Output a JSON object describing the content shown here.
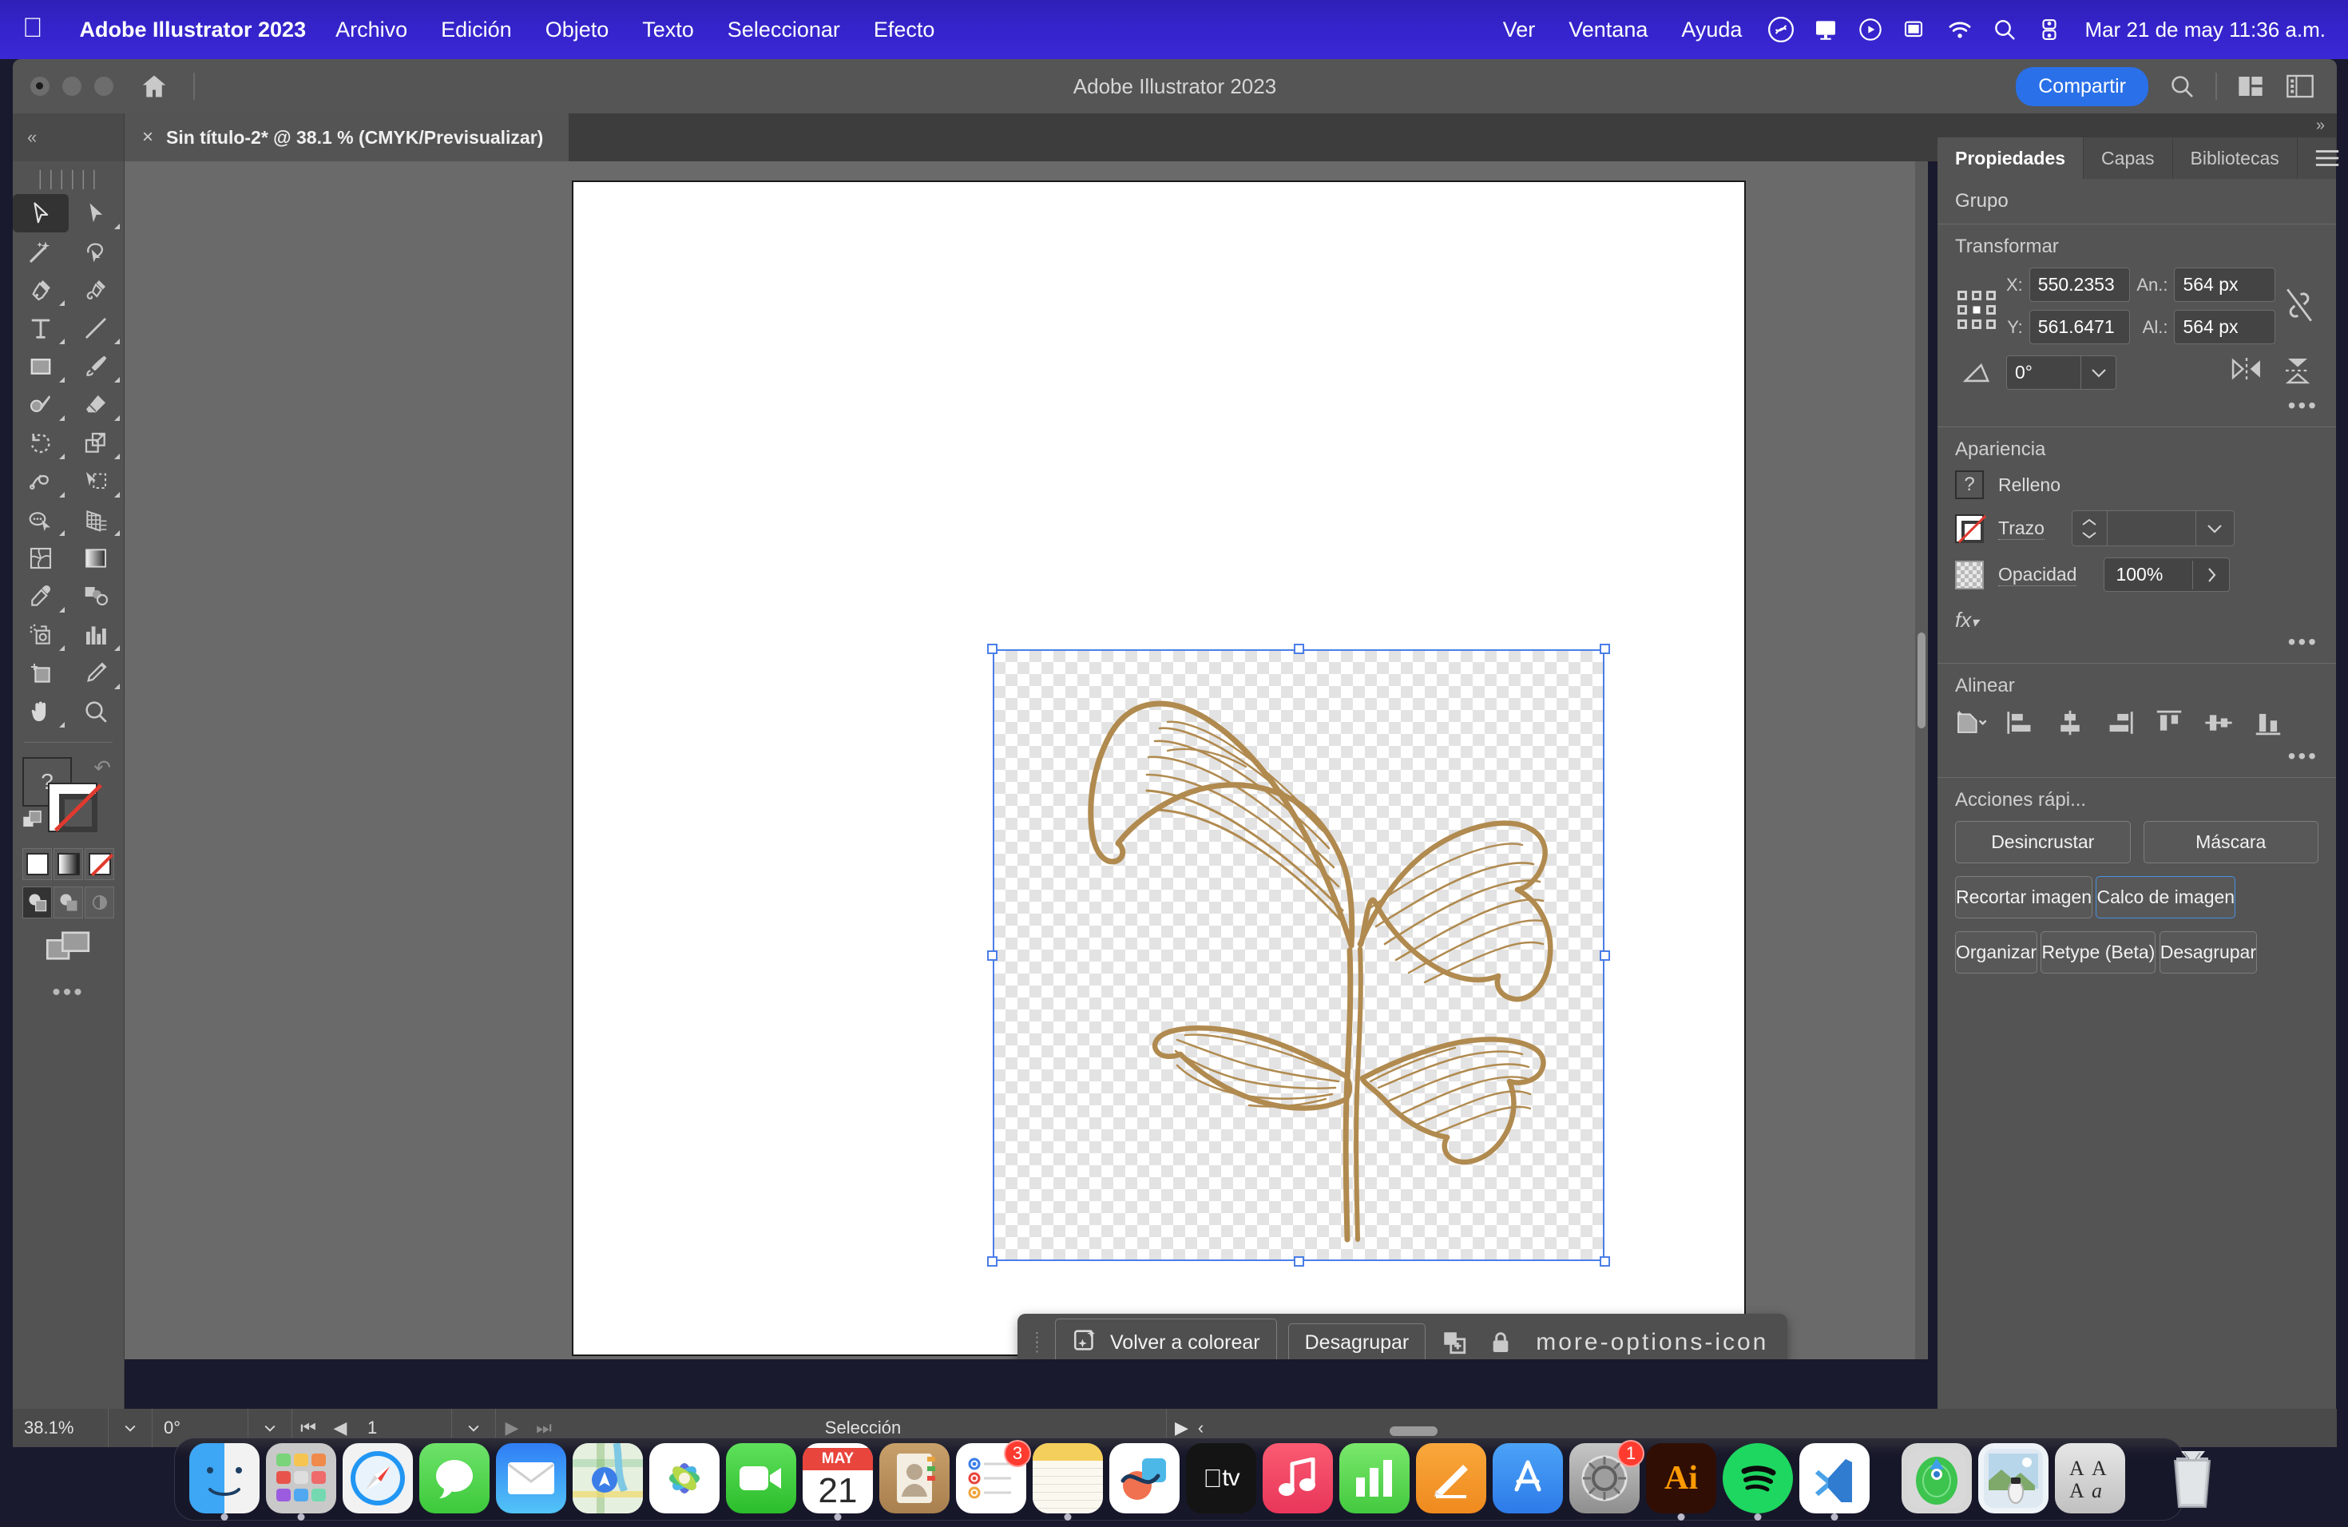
{
  "menubar": {
    "apple_icon": "apple-logo-icon",
    "app_name": "Adobe Illustrator 2023",
    "items": [
      "Archivo",
      "Edición",
      "Objeto",
      "Texto",
      "Seleccionar",
      "Efecto"
    ],
    "right_items": [
      "Ver",
      "Ventana",
      "Ayuda"
    ],
    "status_icons": [
      "shazam-icon",
      "display-icon",
      "now-playing-icon",
      "screen-mirroring-icon",
      "wifi-icon",
      "spotlight-search-icon",
      "control-center-icon"
    ],
    "clock": "Mar 21 de may  11:36 a.m."
  },
  "titlebar": {
    "app_title": "Adobe Illustrator 2023",
    "share_label": "Compartir",
    "icons": [
      "home-icon",
      "search-icon",
      "arrange-documents-icon",
      "workspace-switcher-icon"
    ]
  },
  "tabbar": {
    "collapse_label": "«",
    "document_tab": "Sin título-2* @ 38.1 % (CMYK/Previsualizar)",
    "close_label": "×",
    "expand_label": "»"
  },
  "toolbar": {
    "tools": [
      {
        "name": "selection-tool",
        "selected": true
      },
      {
        "name": "direct-selection-tool",
        "selected": false
      },
      {
        "name": "magic-wand-tool",
        "selected": false
      },
      {
        "name": "lasso-tool",
        "selected": false
      },
      {
        "name": "pen-tool",
        "selected": false
      },
      {
        "name": "curvature-tool",
        "selected": false
      },
      {
        "name": "type-tool",
        "selected": false
      },
      {
        "name": "line-segment-tool",
        "selected": false
      },
      {
        "name": "rectangle-tool",
        "selected": false
      },
      {
        "name": "paintbrush-tool",
        "selected": false
      },
      {
        "name": "shaper-tool",
        "selected": false
      },
      {
        "name": "eraser-tool",
        "selected": false
      },
      {
        "name": "rotate-tool",
        "selected": false
      },
      {
        "name": "scale-tool",
        "selected": false
      },
      {
        "name": "width-tool",
        "selected": false
      },
      {
        "name": "free-transform-tool",
        "selected": false
      },
      {
        "name": "shape-builder-tool",
        "selected": false
      },
      {
        "name": "perspective-grid-tool",
        "selected": false
      },
      {
        "name": "mesh-tool",
        "selected": false
      },
      {
        "name": "gradient-tool",
        "selected": false
      },
      {
        "name": "eyedropper-tool",
        "selected": false
      },
      {
        "name": "blend-tool",
        "selected": false
      },
      {
        "name": "symbol-sprayer-tool",
        "selected": false
      },
      {
        "name": "column-graph-tool",
        "selected": false
      },
      {
        "name": "artboard-tool",
        "selected": false
      },
      {
        "name": "slice-tool",
        "selected": false
      },
      {
        "name": "hand-tool",
        "selected": false
      },
      {
        "name": "zoom-tool",
        "selected": false
      }
    ],
    "fill_label": "?",
    "drawing_modes": [
      "draw-normal",
      "draw-behind",
      "draw-inside"
    ],
    "screen_mode": "change-screen-mode-icon",
    "more_label": "•••"
  },
  "canvas": {
    "artwork_name": "gold-line-art-plant",
    "artwork_stroke_color": "#b08a4f",
    "selection_color": "#4a7ee8",
    "contextual_toolbar": {
      "recolor_label": "Volver a colorear",
      "ungroup_label": "Desagrupar",
      "icons": [
        "duplicate-icon",
        "lock-icon",
        "more-options-icon"
      ]
    }
  },
  "statusbar": {
    "zoom": "38.1%",
    "rotation": "0°",
    "page": "1",
    "tool_status": "Selección"
  },
  "properties": {
    "tabs": [
      {
        "label": "Propiedades",
        "active": true
      },
      {
        "label": "Capas",
        "active": false
      },
      {
        "label": "Bibliotecas",
        "active": false
      }
    ],
    "menu_icon": "panel-menu-icon",
    "object_type": "Grupo",
    "transform": {
      "title": "Transformar",
      "x_label": "X:",
      "x_value": "550.2353",
      "y_label": "Y:",
      "y_value": "561.6471",
      "w_label": "An.:",
      "w_value": "564 px",
      "h_label": "Al.:",
      "h_value": "564 px",
      "angle_label": "∠:",
      "angle_value": "0°",
      "link_icon": "constrain-proportions-off-icon",
      "flip_icons": [
        "flip-horizontal-icon",
        "flip-vertical-icon"
      ],
      "more": "•••"
    },
    "appearance": {
      "title": "Apariencia",
      "fill_label": "Relleno",
      "fill_swatch": "mixed-fill-question-icon",
      "stroke_label": "Trazo",
      "stroke_swatch": "none-stroke-icon",
      "stroke_weight": "",
      "opacity_label": "Opacidad",
      "opacity_value": "100%",
      "fx_label": "fx",
      "more": "•••"
    },
    "align": {
      "title": "Alinear",
      "target_icon": "align-to-selection-icon",
      "icons": [
        "align-left-icon",
        "align-horizontal-center-icon",
        "align-right-icon",
        "align-top-icon",
        "align-vertical-center-icon",
        "align-bottom-icon"
      ],
      "more": "•••"
    },
    "quick_actions": {
      "title": "Acciones rápi...",
      "row1": [
        "Desincrustar",
        "Máscara"
      ],
      "stack": [
        {
          "label": "Recortar imagen",
          "focused": false
        },
        {
          "label": "Calco de imagen",
          "focused": true
        },
        {
          "label": "Organizar",
          "focused": false
        },
        {
          "label": "Retype (Beta)",
          "focused": false
        },
        {
          "label": "Desagrupar",
          "focused": false
        }
      ]
    }
  },
  "dock": {
    "items": [
      {
        "name": "finder",
        "running": true,
        "badge": null
      },
      {
        "name": "launchpad",
        "running": true,
        "badge": null
      },
      {
        "name": "safari",
        "running": false,
        "badge": null
      },
      {
        "name": "messages",
        "running": false,
        "badge": null
      },
      {
        "name": "mail",
        "running": false,
        "badge": null
      },
      {
        "name": "maps",
        "running": false,
        "badge": null
      },
      {
        "name": "photos",
        "running": false,
        "badge": null
      },
      {
        "name": "facetime",
        "running": false,
        "badge": null
      },
      {
        "name": "calendar",
        "running": true,
        "badge": null,
        "month": "MAY",
        "day": "21"
      },
      {
        "name": "contacts",
        "running": false,
        "badge": null
      },
      {
        "name": "reminders",
        "running": false,
        "badge": "3"
      },
      {
        "name": "notes",
        "running": true,
        "badge": null
      },
      {
        "name": "freeform",
        "running": false,
        "badge": null
      },
      {
        "name": "apple-tv",
        "running": false,
        "badge": null
      },
      {
        "name": "music",
        "running": false,
        "badge": null
      },
      {
        "name": "numbers",
        "running": false,
        "badge": null
      },
      {
        "name": "pages",
        "running": false,
        "badge": null
      },
      {
        "name": "app-store",
        "running": false,
        "badge": null
      },
      {
        "name": "system-settings",
        "running": false,
        "badge": "1"
      },
      {
        "name": "adobe-illustrator",
        "running": true,
        "badge": null,
        "short": "Ai"
      },
      {
        "name": "spotify",
        "running": true,
        "badge": null
      },
      {
        "name": "visual-studio-code",
        "running": false,
        "badge": null
      },
      {
        "name": "find-my",
        "running": false,
        "badge": null
      },
      {
        "name": "preview",
        "running": false,
        "badge": null
      },
      {
        "name": "font-book",
        "running": false,
        "badge": null
      },
      {
        "name": "trash",
        "running": false,
        "badge": null
      }
    ]
  }
}
